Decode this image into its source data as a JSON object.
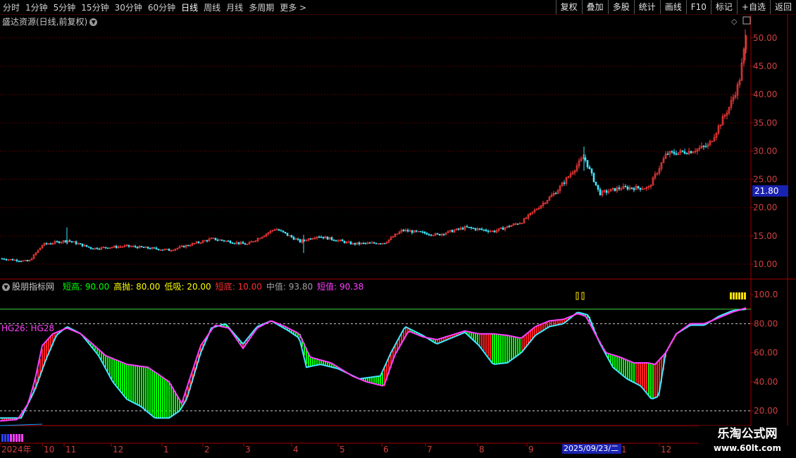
{
  "toolbar": {
    "timeframes": [
      "分时",
      "1分钟",
      "5分钟",
      "15分钟",
      "30分钟",
      "60分钟",
      "日线",
      "周线",
      "月线",
      "多周期",
      "更多 >"
    ],
    "active": "日线",
    "tools": [
      "复权",
      "叠加",
      "多股",
      "统计",
      "画线",
      "F10",
      "标记",
      "+自选",
      "返回"
    ]
  },
  "main_chart": {
    "title": "盛达资源(日线,前复权)",
    "price_ticks": [
      "50.00",
      "45.00",
      "40.00",
      "35.00",
      "30.00",
      "25.00",
      "20.00",
      "15.00",
      "10.00"
    ],
    "current_price": "21.80",
    "chart_data": {
      "type": "candlestick",
      "ylim": [
        8,
        53
      ],
      "series": [
        {
          "name": "",
          "values": []
        }
      ]
    }
  },
  "indicator": {
    "name": "股朋指标网",
    "legend": [
      {
        "label": "短高:",
        "value": "90.00",
        "color": "#00ff00"
      },
      {
        "label": "高抛:",
        "value": "80.00",
        "color": "#ffff00"
      },
      {
        "label": "低吸:",
        "value": "20.00",
        "color": "#ffff00"
      },
      {
        "label": "短底:",
        "value": "10.00",
        "color": "#ff3030"
      },
      {
        "label": "中值:",
        "value": "93.80",
        "color": "#a0a0a0"
      },
      {
        "label": "短值:",
        "value": "90.38",
        "color": "#ff40ff"
      }
    ],
    "sub_label": "HG26: HG28",
    "value_ticks": [
      "100.0",
      "80.00",
      "60.00",
      "40.00",
      "20.00"
    ],
    "chart_data": {
      "type": "line",
      "ylim": [
        0,
        105
      ],
      "series": [
        {
          "name": "短值",
          "values": []
        },
        {
          "name": "中值",
          "values": []
        }
      ]
    }
  },
  "time_axis": {
    "labels": [
      "2024年",
      "10",
      "11",
      "12",
      "1",
      "2",
      "3",
      "4",
      "5",
      "6",
      "7",
      "8",
      "9",
      "1",
      "12"
    ],
    "highlighted_date": "2025/09/23/二"
  },
  "colors": {
    "up": "#ff3c3c",
    "down": "#40e8ff",
    "grid": "#8b0000",
    "magenta": "#ff40ff",
    "cyan": "#40e8ff",
    "green_fill": "#00ff00",
    "red_fill": "#ff2020",
    "level90": "#40d040",
    "highlight_blue": "#1a22b0"
  },
  "watermark": {
    "title": "乐淘公式网",
    "url": "www.60lt.com"
  }
}
